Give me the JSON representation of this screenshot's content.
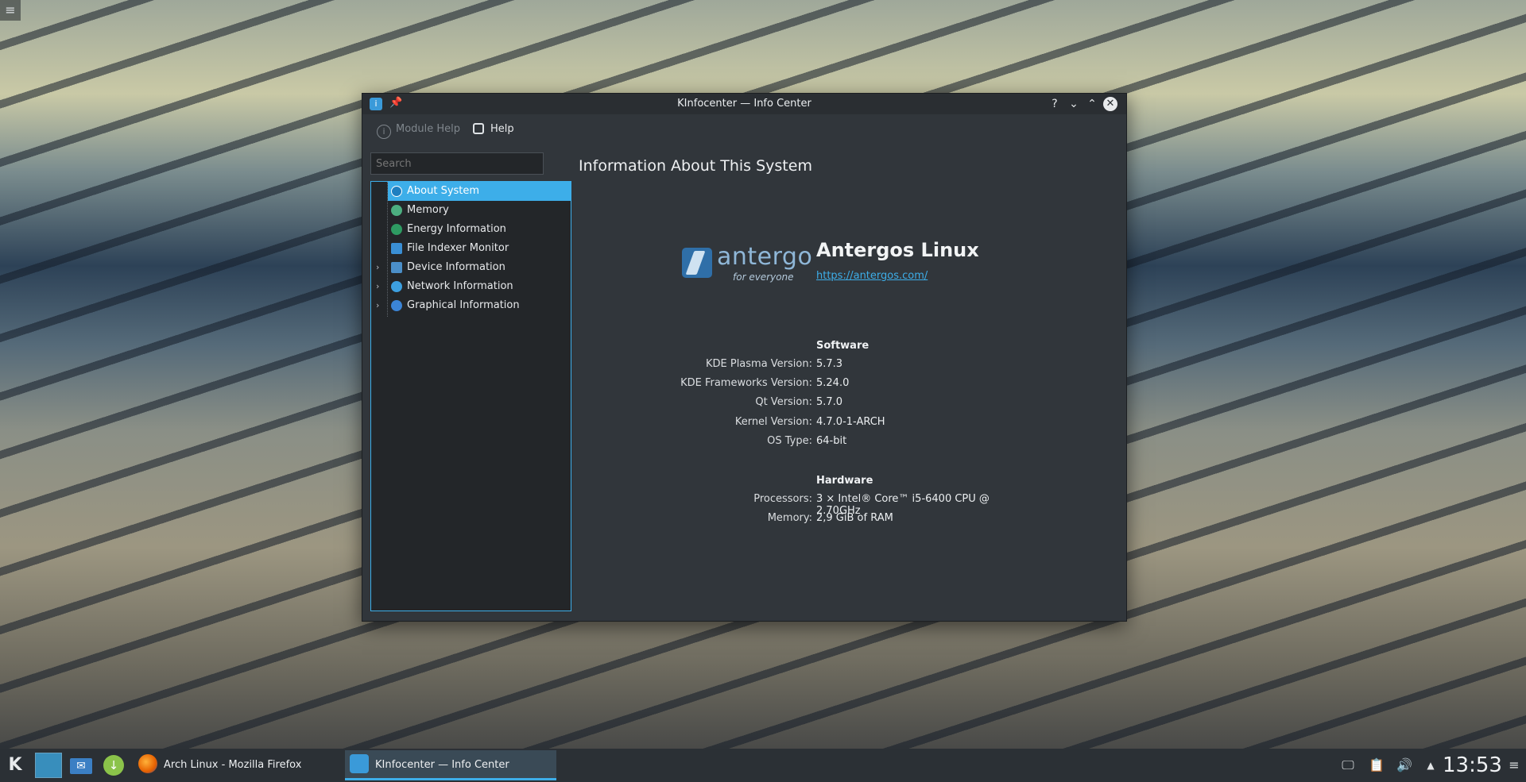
{
  "window": {
    "title": "KInfocenter — Info Center",
    "buttons": {
      "help": "?",
      "minimize": "⌄",
      "maximize": "⌃",
      "close": "✕"
    }
  },
  "toolbar": {
    "module_help": "Module Help",
    "help": "Help"
  },
  "sidebar": {
    "search_placeholder": "Search",
    "items": [
      {
        "label": "About System",
        "selected": true,
        "icon": "info-icon",
        "color": "#3daee9"
      },
      {
        "label": "Memory",
        "icon": "memory-icon",
        "color": "#4caf80"
      },
      {
        "label": "Energy Information",
        "icon": "energy-icon",
        "color": "#2e9b62"
      },
      {
        "label": "File Indexer Monitor",
        "icon": "file-indexer-icon",
        "color": "#3a8fd4"
      },
      {
        "label": "Device Information",
        "expandable": true,
        "icon": "device-icon",
        "color": "#4b8fc8"
      },
      {
        "label": "Network Information",
        "expandable": true,
        "icon": "network-icon",
        "color": "#3da0e0"
      },
      {
        "label": "Graphical Information",
        "expandable": true,
        "icon": "graphics-icon",
        "color": "#3b84d6"
      }
    ]
  },
  "content": {
    "heading": "Information About This System",
    "logo": {
      "word": "antergo",
      "tagline": "for everyone"
    },
    "os_name": "Antergos Linux",
    "os_url": "https://antergos.com/",
    "software_heading": "Software",
    "software": [
      {
        "key": "KDE Plasma Version:",
        "value": "5.7.3"
      },
      {
        "key": "KDE Frameworks Version:",
        "value": "5.24.0"
      },
      {
        "key": "Qt Version:",
        "value": "5.7.0"
      },
      {
        "key": "Kernel Version:",
        "value": "4.7.0-1-ARCH"
      },
      {
        "key": "OS Type:",
        "value": "64-bit"
      }
    ],
    "hardware_heading": "Hardware",
    "hardware": [
      {
        "key": "Processors:",
        "value": "3 × Intel® Core™ i5-6400 CPU @ 2.70GHz"
      },
      {
        "key": "Memory:",
        "value": "2,9 GiB of RAM"
      }
    ]
  },
  "taskbar": {
    "tasks": [
      {
        "label": "Arch Linux - Mozilla Firefox",
        "icon": "firefox-icon"
      },
      {
        "label": "KInfocenter — Info Center",
        "icon": "kinfocenter-icon",
        "active": true
      }
    ],
    "clock": "13:53"
  }
}
